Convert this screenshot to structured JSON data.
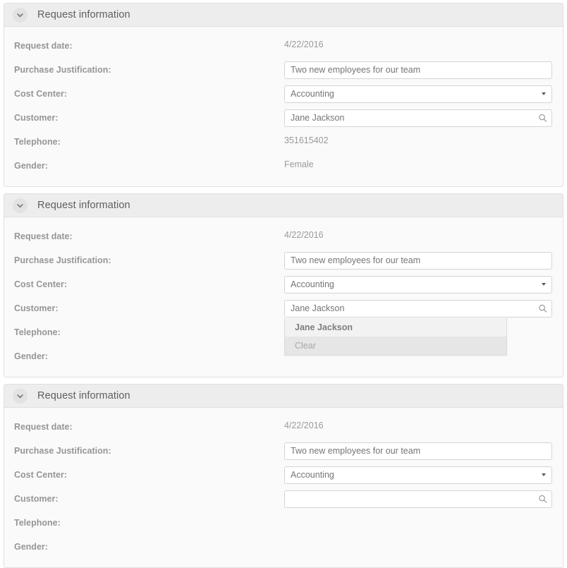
{
  "panels": [
    {
      "title": "Request information",
      "toggle_icon": "chevron-down-icon",
      "fields": {
        "request_date_label": "Request date:",
        "request_date_value": "4/22/2016",
        "purchase_justification_label": "Purchase Justification:",
        "purchase_justification_value": "Two new employees for our team",
        "cost_center_label": "Cost Center:",
        "cost_center_value": "Accounting",
        "customer_label": "Customer:",
        "customer_value": "Jane Jackson",
        "telephone_label": "Telephone:",
        "telephone_value": "351615402",
        "gender_label": "Gender:",
        "gender_value": "Female"
      }
    },
    {
      "title": "Request information",
      "toggle_icon": "chevron-down-icon",
      "fields": {
        "request_date_label": "Request date:",
        "request_date_value": "4/22/2016",
        "purchase_justification_label": "Purchase Justification:",
        "purchase_justification_value": "Two new employees for our team",
        "cost_center_label": "Cost Center:",
        "cost_center_value": "Accounting",
        "customer_label": "Customer:",
        "customer_value": "Jane Jackson",
        "telephone_label": "Telephone:",
        "telephone_value": "",
        "gender_label": "Gender:",
        "gender_value": ""
      },
      "autocomplete": {
        "open": true,
        "items": [
          {
            "label": "Jane Jackson",
            "state": "active"
          },
          {
            "label": "Clear",
            "state": "clear"
          }
        ]
      }
    },
    {
      "title": "Request information",
      "toggle_icon": "chevron-down-icon",
      "fields": {
        "request_date_label": "Request date:",
        "request_date_value": "4/22/2016",
        "purchase_justification_label": "Purchase Justification:",
        "purchase_justification_value": "Two new employees for our team",
        "cost_center_label": "Cost Center:",
        "cost_center_value": "Accounting",
        "customer_label": "Customer:",
        "customer_value": "",
        "telephone_label": "Telephone:",
        "telephone_value": "",
        "gender_label": "Gender:",
        "gender_value": ""
      }
    }
  ],
  "icons": {
    "chevron_down": "chevron-down-icon",
    "search": "search-icon",
    "select_caret": "caret-down-icon"
  },
  "colors": {
    "panel_header_bg": "#ededed",
    "panel_body_bg": "#fafafa",
    "panel_border": "#e0e0e0",
    "label_text": "#969696",
    "value_text": "#9a9a9a",
    "input_border": "#d4d4d4",
    "dropdown_bg": "#e6e6e6",
    "dropdown_active_bg": "#f2f2f2"
  }
}
